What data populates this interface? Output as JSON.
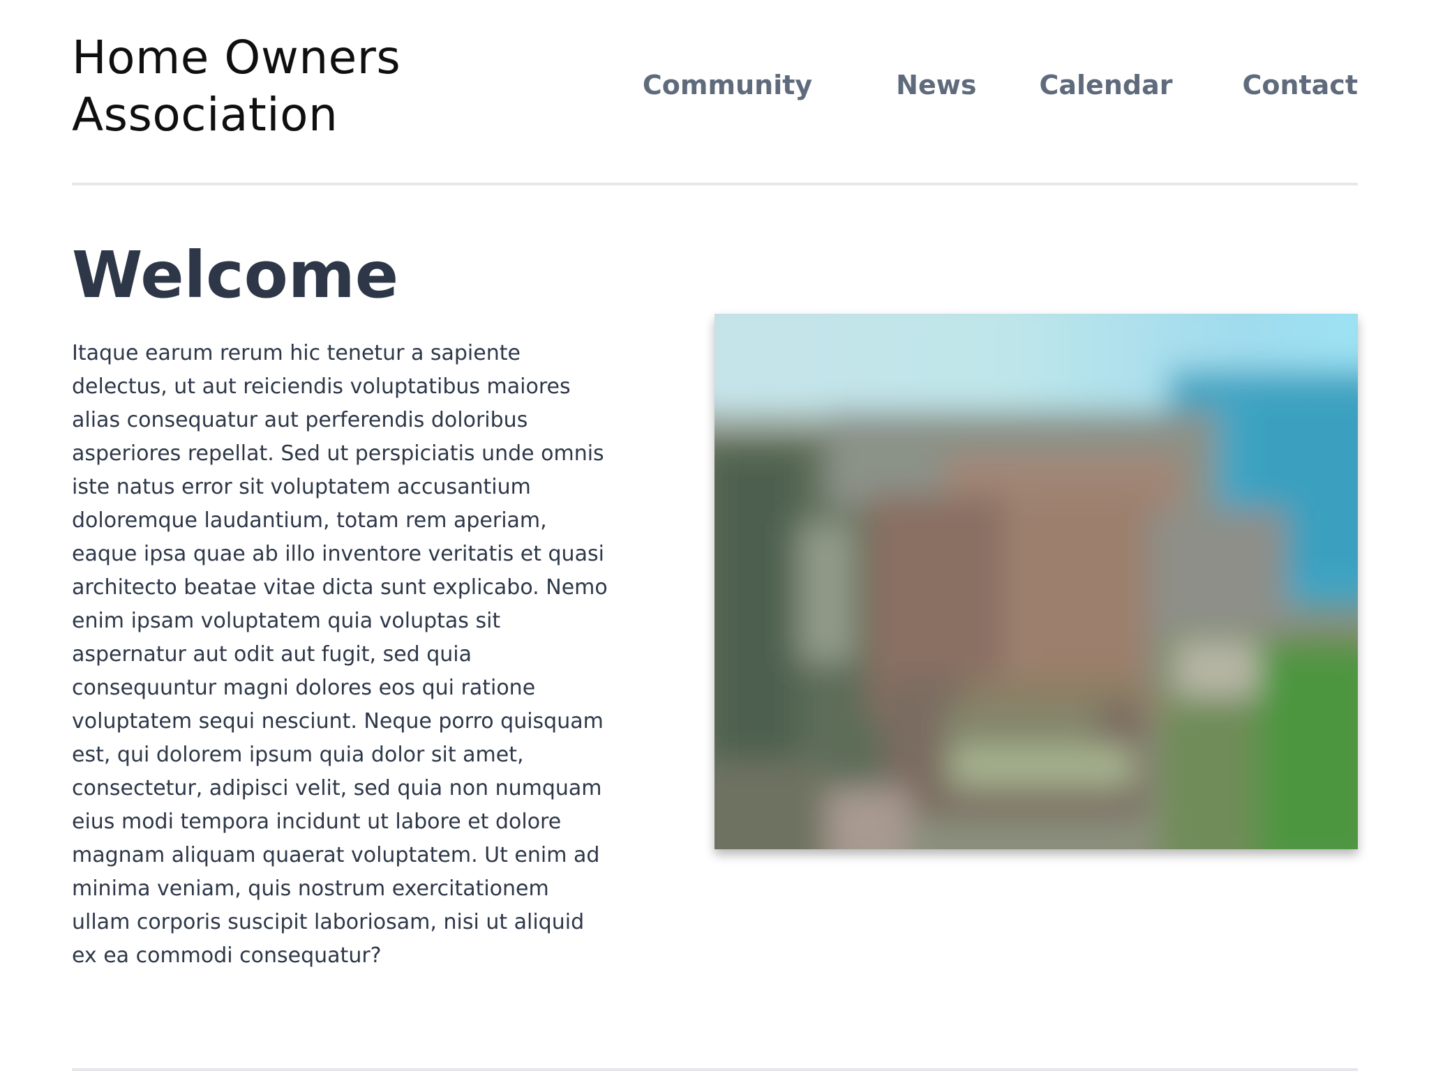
{
  "header": {
    "site_title": "Home Owners Association",
    "nav": [
      {
        "label": "Community"
      },
      {
        "label": "News"
      },
      {
        "label": "Calendar"
      },
      {
        "label": "Contact"
      }
    ]
  },
  "main": {
    "heading": "Welcome",
    "body": "Itaque earum rerum hic tenetur a sapiente delectus, ut aut reiciendis voluptatibus maiores alias consequatur aut perferendis doloribus asperiores repellat. Sed ut perspiciatis unde omnis iste natus error sit voluptatem accusantium doloremque laudantium, totam rem aperiam, eaque ipsa quae ab illo inventore veritatis et quasi architecto beatae vitae dicta sunt explicabo. Nemo enim ipsam voluptatem quia voluptas sit aspernatur aut odit aut fugit, sed quia consequuntur magni dolores eos qui ratione voluptatem sequi nesciunt. Neque porro quisquam est, qui dolorem ipsum quia dolor sit amet, consectetur, adipisci velit, sed quia non numquam eius modi tempora incidunt ut labore et dolore magnam aliquam quaerat voluptatem. Ut enim ad minima veniam, quis nostrum exercitationem ullam corporis suscipit laboriosam, nisi ut aliquid ex ea commodi consequatur?"
  },
  "colors": {
    "heading": "#2d3748",
    "nav_link": "#5f6b7c",
    "divider": "#e5e7eb"
  }
}
